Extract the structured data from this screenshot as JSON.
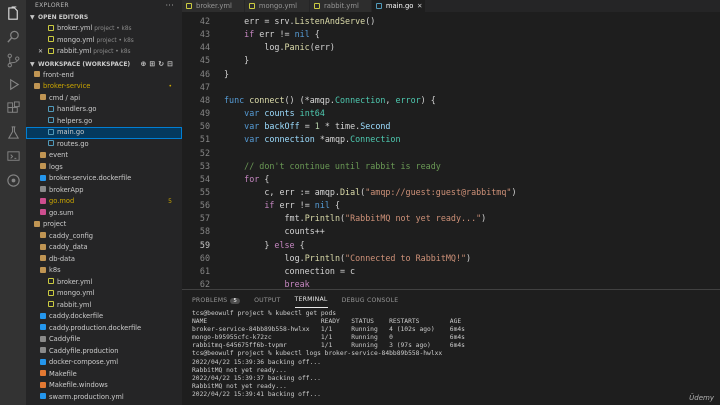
{
  "sidebar": {
    "title": "EXPLORER",
    "open_editors_label": "OPEN EDITORS",
    "open_editors": [
      {
        "name": "broker.yml",
        "desc": "project • k8s",
        "icon_color": "#cbcb41"
      },
      {
        "name": "mongo.yml",
        "desc": "project • k8s",
        "icon_color": "#cbcb41"
      },
      {
        "name": "rabbit.yml",
        "desc": "project • k8s",
        "icon_color": "#cbcb41"
      }
    ],
    "workspace_label": "WORKSPACE (WORKSPACE)",
    "tree": [
      {
        "name": "front-end",
        "kind": "folder",
        "color": "#cccccc"
      },
      {
        "name": "broker-service",
        "kind": "folder",
        "color": "#cca700",
        "badge": "•"
      },
      {
        "name": "cmd / api",
        "kind": "folder",
        "color": "#cccccc"
      },
      {
        "name": "handlers.go",
        "kind": "go",
        "color": "#cccccc"
      },
      {
        "name": "helpers.go",
        "kind": "go",
        "color": "#cccccc"
      },
      {
        "name": "main.go",
        "kind": "go",
        "color": "#cccccc"
      },
      {
        "name": "routes.go",
        "kind": "go",
        "color": "#cccccc"
      },
      {
        "name": "event",
        "kind": "folder",
        "color": "#cccccc"
      },
      {
        "name": "logs",
        "kind": "folder",
        "color": "#cccccc"
      },
      {
        "name": "broker-service.dockerfile",
        "kind": "docker",
        "color": "#cccccc"
      },
      {
        "name": "brokerApp",
        "kind": "file",
        "color": "#cccccc"
      },
      {
        "name": "go.mod",
        "kind": "mod",
        "color": "#cca700",
        "badge": "5"
      },
      {
        "name": "go.sum",
        "kind": "mod",
        "color": "#cccccc"
      },
      {
        "name": "project",
        "kind": "folder",
        "color": "#cccccc"
      },
      {
        "name": "caddy_config",
        "kind": "folder",
        "color": "#cccccc"
      },
      {
        "name": "caddy_data",
        "kind": "folder",
        "color": "#cccccc"
      },
      {
        "name": "db-data",
        "kind": "folder",
        "color": "#cccccc"
      },
      {
        "name": "k8s",
        "kind": "folder",
        "color": "#cccccc"
      },
      {
        "name": "broker.yml",
        "kind": "yml",
        "color": "#cccccc"
      },
      {
        "name": "mongo.yml",
        "kind": "yml",
        "color": "#cccccc"
      },
      {
        "name": "rabbit.yml",
        "kind": "yml",
        "color": "#cccccc"
      },
      {
        "name": "caddy.dockerfile",
        "kind": "docker",
        "color": "#cccccc"
      },
      {
        "name": "caddy.production.dockerfile",
        "kind": "docker",
        "color": "#cccccc"
      },
      {
        "name": "Caddyfile",
        "kind": "file",
        "color": "#cccccc"
      },
      {
        "name": "Caddyfile.production",
        "kind": "file",
        "color": "#cccccc"
      },
      {
        "name": "docker-compose.yml",
        "kind": "docker",
        "color": "#cccccc"
      },
      {
        "name": "Makefile",
        "kind": "make",
        "color": "#cccccc"
      },
      {
        "name": "Makefile.windows",
        "kind": "make",
        "color": "#cccccc"
      },
      {
        "name": "swarm.production.yml",
        "kind": "docker",
        "color": "#cccccc"
      }
    ]
  },
  "tabs": [
    {
      "label": "broker.yml",
      "icon_color": "#cbcb41"
    },
    {
      "label": "mongo.yml",
      "icon_color": "#cbcb41"
    },
    {
      "label": "rabbit.yml",
      "icon_color": "#cbcb41"
    },
    {
      "label": "main.go",
      "icon_color": "#519aba",
      "active": true
    }
  ],
  "editor": {
    "current_line": "59",
    "lines": [
      {
        "n": "42",
        "t": [
          [
            "pl",
            "    err = srv."
          ],
          [
            "fn",
            "ListenAndServe"
          ],
          [
            "pl",
            "()"
          ]
        ]
      },
      {
        "n": "43",
        "t": [
          [
            "pl",
            "    "
          ],
          [
            "ctl",
            "if"
          ],
          [
            "pl",
            " err != "
          ],
          [
            "kw",
            "nil"
          ],
          [
            "pl",
            " {"
          ]
        ]
      },
      {
        "n": "44",
        "t": [
          [
            "pl",
            "        log."
          ],
          [
            "fn",
            "Panic"
          ],
          [
            "pl",
            "(err)"
          ]
        ]
      },
      {
        "n": "45",
        "t": [
          [
            "pl",
            "    }"
          ]
        ]
      },
      {
        "n": "46",
        "t": [
          [
            "pl",
            "}"
          ]
        ]
      },
      {
        "n": "47",
        "t": [
          [
            "pl",
            ""
          ]
        ]
      },
      {
        "n": "48",
        "t": [
          [
            "kw",
            "func"
          ],
          [
            "pl",
            " "
          ],
          [
            "fn",
            "connect"
          ],
          [
            "pl",
            "() (*amqp."
          ],
          [
            "type",
            "Connection"
          ],
          [
            "pl",
            ", "
          ],
          [
            "type",
            "error"
          ],
          [
            "pl",
            ") {"
          ]
        ]
      },
      {
        "n": "49",
        "t": [
          [
            "pl",
            "    "
          ],
          [
            "kw",
            "var"
          ],
          [
            "pl",
            " "
          ],
          [
            "var",
            "counts"
          ],
          [
            "pl",
            " "
          ],
          [
            "type",
            "int64"
          ]
        ]
      },
      {
        "n": "50",
        "t": [
          [
            "pl",
            "    "
          ],
          [
            "kw",
            "var"
          ],
          [
            "pl",
            " "
          ],
          [
            "var",
            "backOff"
          ],
          [
            "pl",
            " = "
          ],
          [
            "num",
            "1"
          ],
          [
            "pl",
            " * time."
          ],
          [
            "var",
            "Second"
          ]
        ]
      },
      {
        "n": "51",
        "t": [
          [
            "pl",
            "    "
          ],
          [
            "kw",
            "var"
          ],
          [
            "pl",
            " "
          ],
          [
            "var",
            "connection"
          ],
          [
            "pl",
            " *amqp."
          ],
          [
            "type",
            "Connection"
          ]
        ]
      },
      {
        "n": "52",
        "t": [
          [
            "pl",
            ""
          ]
        ]
      },
      {
        "n": "53",
        "t": [
          [
            "com",
            "    // don't continue until rabbit is ready"
          ]
        ]
      },
      {
        "n": "54",
        "t": [
          [
            "pl",
            "    "
          ],
          [
            "ctl",
            "for"
          ],
          [
            "pl",
            " {"
          ]
        ]
      },
      {
        "n": "55",
        "t": [
          [
            "pl",
            "        c, err := amqp."
          ],
          [
            "fn",
            "Dial"
          ],
          [
            "pl",
            "("
          ],
          [
            "str",
            "\"amqp://guest:guest@rabbitmq\""
          ],
          [
            "pl",
            ")"
          ]
        ]
      },
      {
        "n": "56",
        "t": [
          [
            "pl",
            "        "
          ],
          [
            "ctl",
            "if"
          ],
          [
            "pl",
            " err != "
          ],
          [
            "kw",
            "nil"
          ],
          [
            "pl",
            " {"
          ]
        ]
      },
      {
        "n": "57",
        "t": [
          [
            "pl",
            "            fmt."
          ],
          [
            "fn",
            "Println"
          ],
          [
            "pl",
            "("
          ],
          [
            "str",
            "\"RabbitMQ not yet ready...\""
          ],
          [
            "pl",
            ")"
          ]
        ]
      },
      {
        "n": "58",
        "t": [
          [
            "pl",
            "            counts++"
          ]
        ]
      },
      {
        "n": "59",
        "t": [
          [
            "pl",
            "        } "
          ],
          [
            "ctl",
            "else"
          ],
          [
            "pl",
            " {"
          ]
        ]
      },
      {
        "n": "60",
        "t": [
          [
            "pl",
            "            log."
          ],
          [
            "fn",
            "Println"
          ],
          [
            "pl",
            "("
          ],
          [
            "str",
            "\"Connected to RabbitMQ!\""
          ],
          [
            "pl",
            ")"
          ]
        ]
      },
      {
        "n": "61",
        "t": [
          [
            "pl",
            "            connection = c"
          ]
        ]
      },
      {
        "n": "62",
        "t": [
          [
            "pl",
            "            "
          ],
          [
            "ctl",
            "break"
          ]
        ]
      }
    ]
  },
  "panel": {
    "tabs": [
      {
        "label": "PROBLEMS",
        "badge": "5"
      },
      {
        "label": "OUTPUT"
      },
      {
        "label": "TERMINAL",
        "active": true
      },
      {
        "label": "DEBUG CONSOLE"
      }
    ],
    "terminal_lines": [
      "tcs@beowulf project % kubectl get pods",
      "NAME                              READY   STATUS    RESTARTS        AGE",
      "broker-service-84bb89b558-hwlxx   1/1     Running   4 (102s ago)    6m4s",
      "mongo-b95955cfc-k72zc             1/1     Running   0               6m4s",
      "rabbitmq-645675ff6b-tvpmr         1/1     Running   3 (97s ago)     6m4s",
      "tcs@beowulf project % kubectl logs broker-service-84bb89b558-hwlxx",
      "2022/04/22 15:39:36 backing off...",
      "RabbitMQ not yet ready...",
      "2022/04/22 15:39:37 backing off...",
      "RabbitMQ not yet ready...",
      "2022/04/22 15:39:41 backing off..."
    ]
  },
  "watermark": "Ūdemy",
  "colors": {
    "accent": "#007fd4",
    "selection": "#04395e",
    "modified": "#cca700"
  }
}
